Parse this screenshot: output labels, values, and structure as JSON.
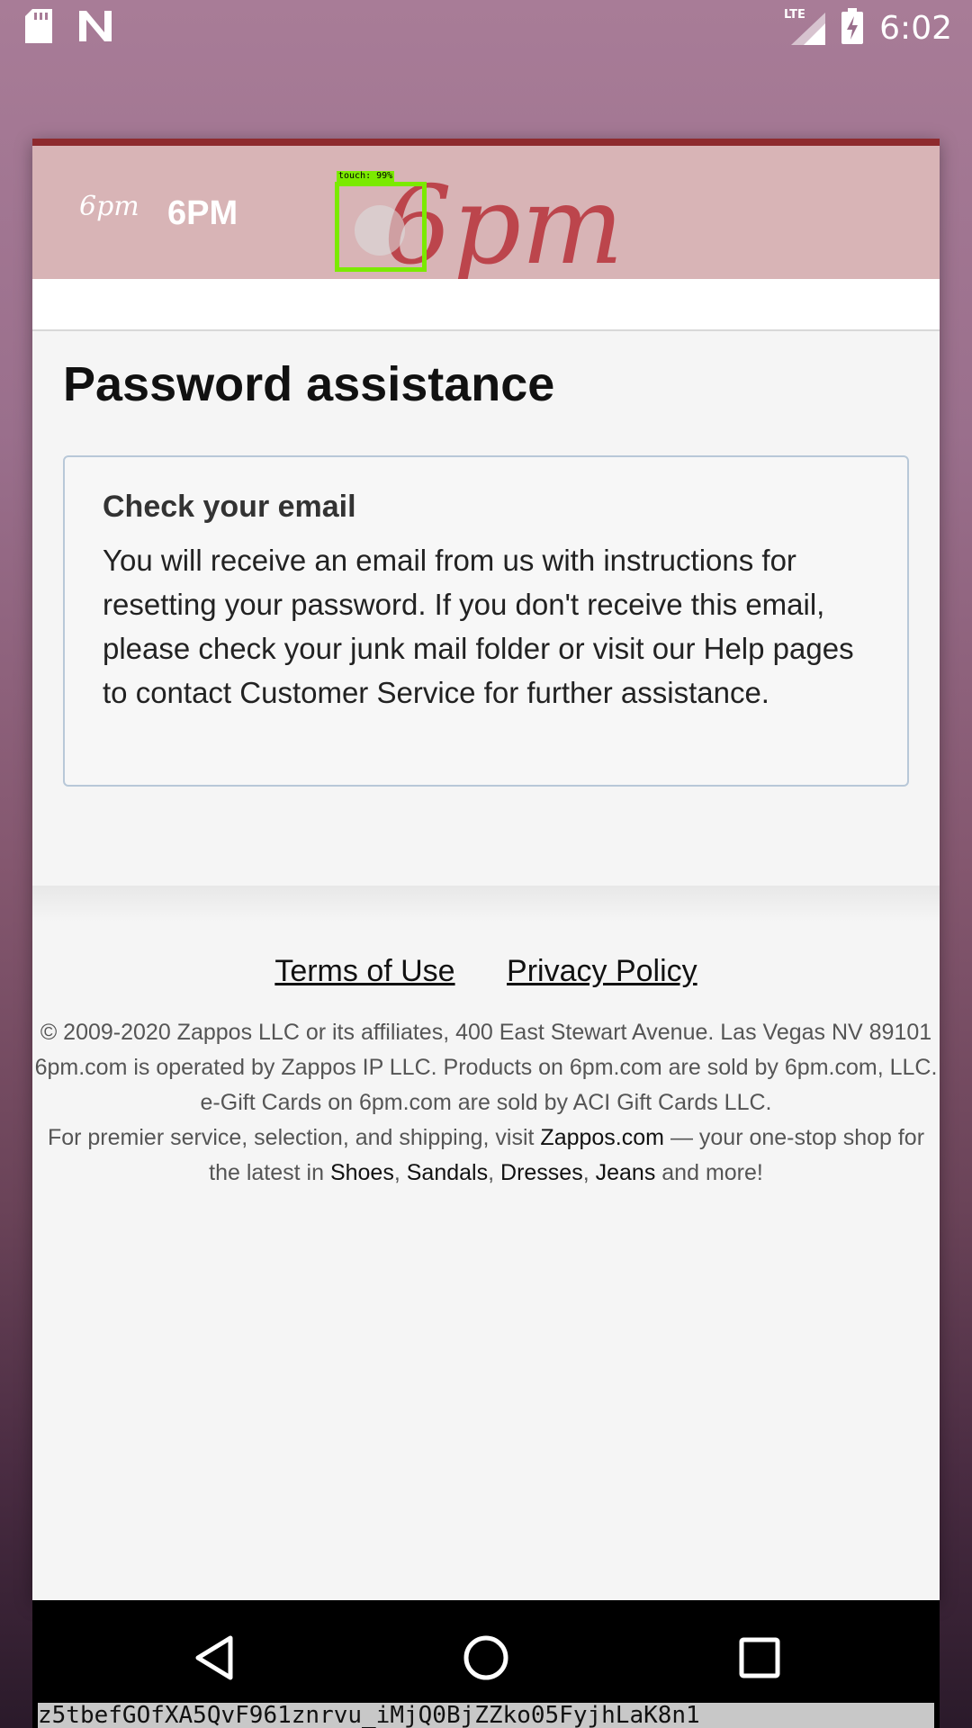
{
  "status_bar": {
    "time": "6:02",
    "network": "LTE",
    "icons": [
      "sd-card-icon",
      "n-logo-icon",
      "lte-signal-icon",
      "battery-charging-icon"
    ]
  },
  "header": {
    "small_logo": "6pm",
    "app_name": "6PM",
    "brand_logo": "6pm",
    "touch_label": "touch: 99%"
  },
  "main": {
    "title": "Password assistance",
    "info_heading": "Check your email",
    "info_body": "You will receive an email from us with instructions for resetting your password. If you don't receive this email, please check your junk mail folder or visit our Help pages to contact Customer Service for further assistance."
  },
  "footer": {
    "terms": "Terms of Use",
    "privacy": "Privacy Policy",
    "copyright": "© 2009-2020 Zappos LLC or its affiliates, 400 East Stewart Avenue. Las Vegas NV 89101",
    "operated": "6pm.com is operated by Zappos IP LLC. Products on 6pm.com are sold by 6pm.com, LLC.",
    "gift_cards": "e-Gift Cards on 6pm.com are sold by ACI Gift Cards LLC.",
    "premier_prefix": "For premier service, selection, and shipping, visit",
    "zappos_link": "Zappos.com",
    "premier_middle": "— your one-stop shop for the latest in",
    "link_shoes": "Shoes",
    "link_sandals": "Sandals",
    "link_dresses": "Dresses",
    "link_jeans": "Jeans",
    "premier_suffix": "and more!"
  },
  "debug_text": "z5tbefGOfXA5QvF961znrvu_iMjQ0BjZZko05FyjhLaK8n1",
  "colors": {
    "header_bg": "#d8b4b6",
    "header_accent": "#8e2a2e",
    "brand_red": "#b8323a",
    "touch_box": "#7bea00"
  }
}
